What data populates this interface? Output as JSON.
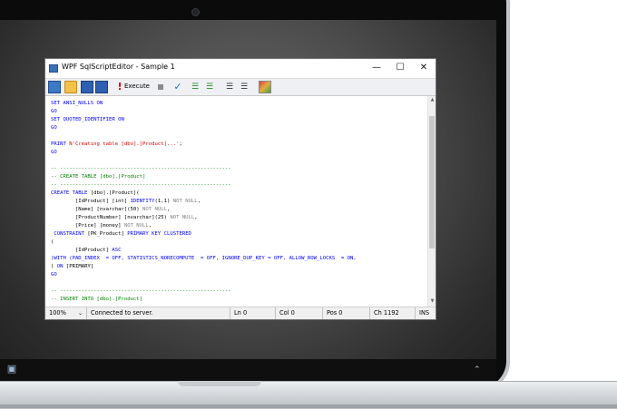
{
  "window": {
    "title": "WPF SqlScriptEditor - Sample 1",
    "controls": {
      "minimize": "—",
      "maximize": "☐",
      "close": "✕"
    }
  },
  "toolbar": {
    "execute_label": "Execute"
  },
  "editor": {
    "lines": [
      [
        [
          "SET ANSI_NULLS ON",
          "kw"
        ]
      ],
      [
        [
          "GO",
          "kw"
        ]
      ],
      [
        [
          "SET QUOTED_IDENTIFIER ON",
          "kw"
        ]
      ],
      [
        [
          "GO",
          "kw"
        ]
      ],
      [],
      [
        [
          "PRINT ",
          "kw"
        ],
        [
          "N'Creating table [dbo].[Product]...'",
          "st"
        ],
        [
          ";",
          "bk"
        ]
      ],
      [
        [
          "GO",
          "kw"
        ]
      ],
      [],
      [
        [
          "-- --------------------------------------------------------",
          "cm"
        ]
      ],
      [
        [
          "-- CREATE TABLE [dbo].[Product]",
          "cm"
        ]
      ],
      [
        [
          "-- --------------------------------------------------------",
          "cm"
        ]
      ],
      [
        [
          "CREATE TABLE ",
          "kw"
        ],
        [
          "[dbo].[Product](",
          "bk"
        ]
      ],
      [
        [
          "        [IdProduct] [int] ",
          "bk"
        ],
        [
          "IDENTITY",
          "kw"
        ],
        [
          "(1,1) ",
          "bk"
        ],
        [
          "NOT NULL",
          "gr"
        ],
        [
          ",",
          "bk"
        ]
      ],
      [
        [
          "        [Name] [nvarchar](50) ",
          "bk"
        ],
        [
          "NOT NULL",
          "gr"
        ],
        [
          ",",
          "bk"
        ]
      ],
      [
        [
          "        [ProductNumber] [nvarchar](25) ",
          "bk"
        ],
        [
          "NOT NULL",
          "gr"
        ],
        [
          ",",
          "bk"
        ]
      ],
      [
        [
          "        [Price] [money] ",
          "bk"
        ],
        [
          "NOT NULL",
          "gr"
        ],
        [
          ",",
          "bk"
        ]
      ],
      [
        [
          " CONSTRAINT ",
          "kw"
        ],
        [
          "[PK_Product] ",
          "bk"
        ],
        [
          "PRIMARY KEY CLUSTERED",
          "kw"
        ]
      ],
      [
        [
          "(",
          "bk"
        ]
      ],
      [
        [
          "        [IdProduct] ",
          "bk"
        ],
        [
          "ASC",
          "kw"
        ]
      ],
      [
        [
          ")WITH (PAD_INDEX  = OFF, STATISTICS_NORECOMPUTE  = OFF, IGNORE_DUP_KEY = OFF, ALLOW_ROW_LOCKS  = ON,",
          "kw"
        ]
      ],
      [
        [
          ") ",
          "bk"
        ],
        [
          "ON ",
          "kw"
        ],
        [
          "[PRIMARY]",
          "bk"
        ]
      ],
      [
        [
          "GO",
          "kw"
        ]
      ],
      [],
      [
        [
          "-- --------------------------------------------------------",
          "cm"
        ]
      ],
      [
        [
          "-- INSERT INTO [dbo].[Product]",
          "cm"
        ]
      ]
    ]
  },
  "statusbar": {
    "zoom": "100%",
    "message": "Connected to server.",
    "line": "Ln 0",
    "column": "Col 0",
    "position": "Pos 0",
    "char": "Ch 1192",
    "mode": "INS"
  },
  "colors": {
    "keyword": "#0000ff",
    "string": "#e00000",
    "comment": "#008000",
    "null_gray": "#808080"
  }
}
